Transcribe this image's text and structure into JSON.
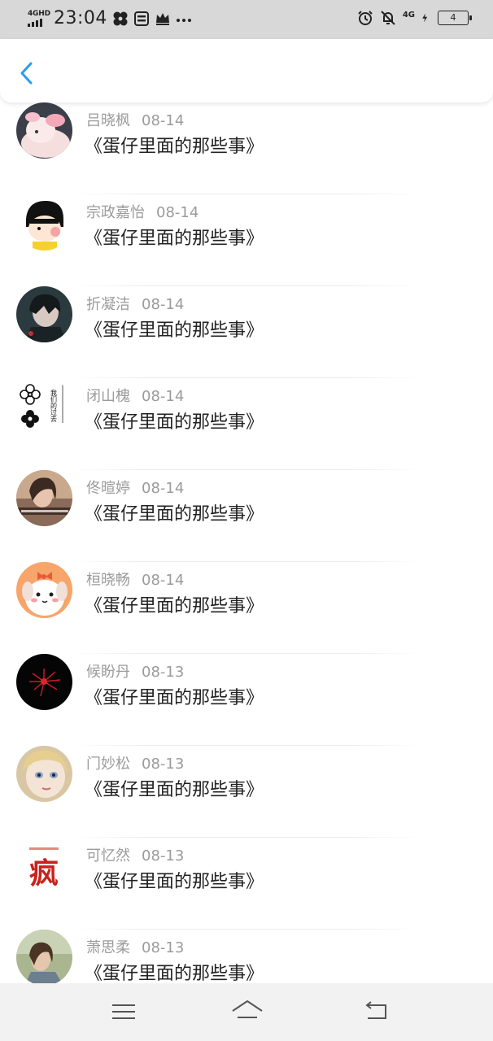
{
  "status_bar": {
    "network": "4GHD",
    "time": "23:04",
    "net_right": "4G",
    "battery": "4"
  },
  "header": {
    "back_icon": "chevron-left-icon",
    "accent_color": "#2b9bf0"
  },
  "items": [
    {
      "name": "吕晓枫",
      "date": "08-14",
      "title": "《蛋仔里面的那些事》",
      "avatar": "unicorn"
    },
    {
      "name": "宗政嘉怡",
      "date": "08-14",
      "title": "《蛋仔里面的那些事》",
      "avatar": "cartoon-girl"
    },
    {
      "name": "折凝洁",
      "date": "08-14",
      "title": "《蛋仔里面的那些事》",
      "avatar": "anime-boy"
    },
    {
      "name": "闭山槐",
      "date": "08-14",
      "title": "《蛋仔里面的那些事》",
      "avatar": "flowers-text",
      "avatar_text": "我们的过去"
    },
    {
      "name": "佟暄婷",
      "date": "08-14",
      "title": "《蛋仔里面的那些事》",
      "avatar": "girl-photo"
    },
    {
      "name": "桓晓畅",
      "date": "08-14",
      "title": "《蛋仔里面的那些事》",
      "avatar": "cute-dog"
    },
    {
      "name": "候盼丹",
      "date": "08-13",
      "title": "《蛋仔里面的那些事》",
      "avatar": "red-flower-dark"
    },
    {
      "name": "门妙松",
      "date": "08-13",
      "title": "《蛋仔里面的那些事》",
      "avatar": "blonde-doll"
    },
    {
      "name": "可忆然",
      "date": "08-13",
      "title": "《蛋仔里面的那些事》",
      "avatar": "red-calligraphy",
      "avatar_text": "疯"
    },
    {
      "name": "萧思柔",
      "date": "08-13",
      "title": "《蛋仔里面的那些事》",
      "avatar": "outdoor-girl"
    }
  ],
  "navbar": {
    "menu_icon": "menu-icon",
    "home_icon": "home-icon",
    "back_icon": "back-icon"
  }
}
